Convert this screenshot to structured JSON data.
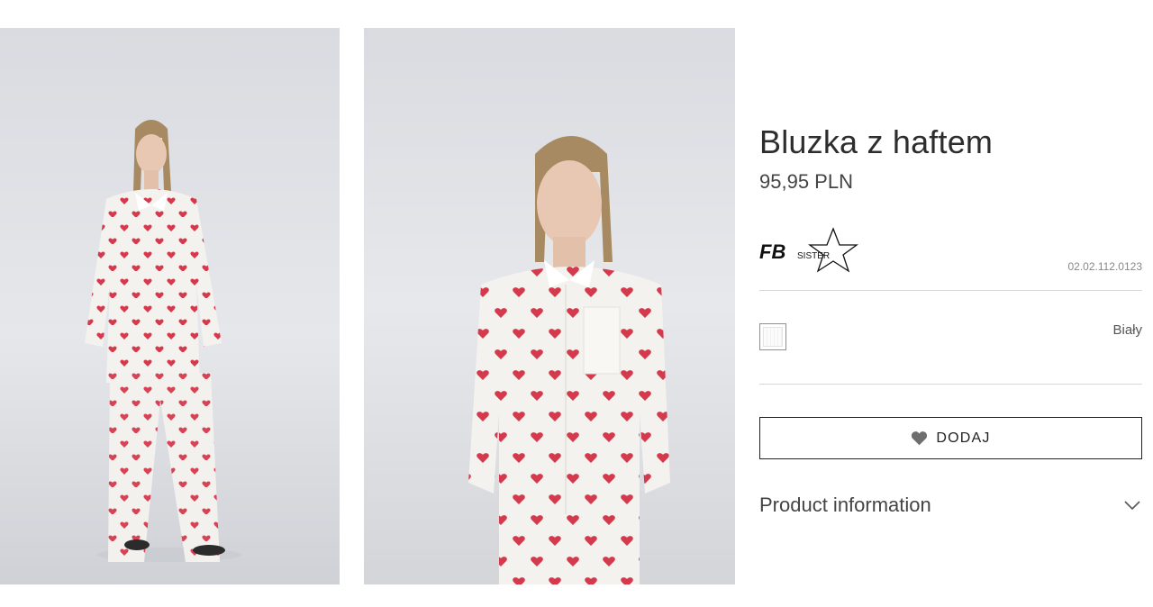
{
  "product": {
    "title": "Bluzka z haftem",
    "price": "95,95 PLN",
    "sku": "02.02.112.0123",
    "brand": {
      "logo_text": "FB",
      "logo_subtext": "SISTER",
      "icon": "star-logo-icon"
    },
    "color": {
      "name": "Biały",
      "swatch": "#f7f7f7"
    }
  },
  "actions": {
    "add_label": "DODAJ",
    "add_icon": "heart-icon"
  },
  "accordion": {
    "label": "Product information",
    "icon": "chevron-down-icon"
  },
  "gallery": {
    "images": [
      "model-full-length-photo",
      "model-half-length-photo"
    ]
  },
  "colors": {
    "text_dark": "#2d2d2d",
    "heart_red": "#d0243a",
    "border": "#222222"
  }
}
